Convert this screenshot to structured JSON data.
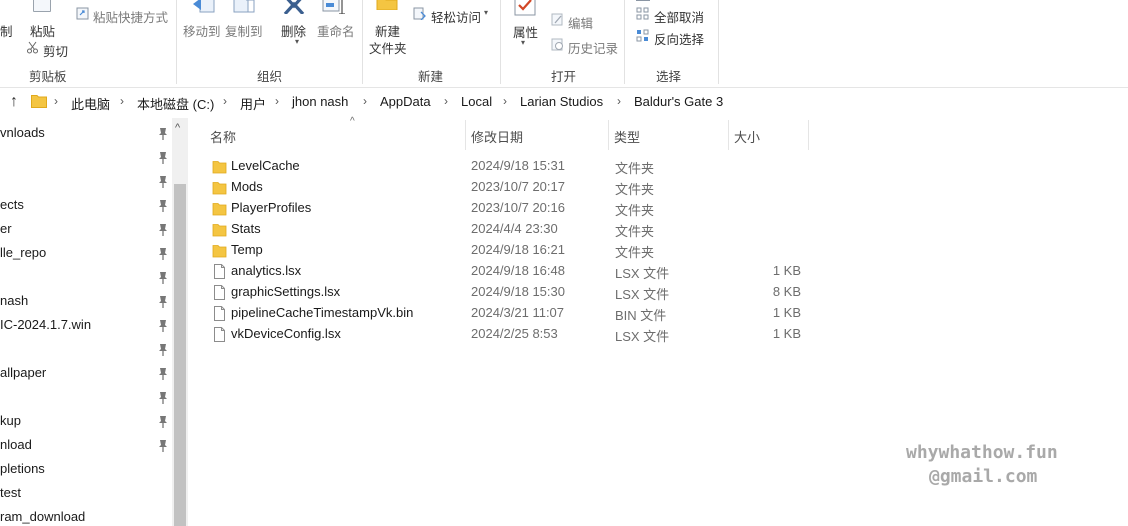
{
  "ribbon": {
    "clipboard": {
      "pin_label": "制",
      "copy_label": "复制",
      "paste_label": "粘贴",
      "paste_shortcut_label": "粘贴快捷方式",
      "cut_label": "剪切",
      "group_label": "剪贴板"
    },
    "organize": {
      "move_to_label": "移动到",
      "copy_to_label": "复制到",
      "delete_label": "删除",
      "rename_label": "重命名",
      "group_label": "组织"
    },
    "new": {
      "new_folder_line1": "新建",
      "new_folder_line2": "文件夹",
      "easy_access_label": "轻松访问",
      "group_label": "新建"
    },
    "open": {
      "properties_label": "属性",
      "edit_label": "编辑",
      "history_label": "历史记录",
      "group_label": "打开"
    },
    "select": {
      "select_none_label": "全部取消",
      "invert_selection_label": "反向选择",
      "group_label": "选择"
    }
  },
  "breadcrumb": [
    "此电脑",
    "本地磁盘 (C:)",
    "用户",
    "jhon nash",
    "AppData",
    "Local",
    "Larian Studios",
    "Baldur's Gate 3"
  ],
  "nav_items": [
    {
      "label": "vnloads",
      "pinned": true
    },
    {
      "label": "",
      "pinned": true
    },
    {
      "label": "",
      "pinned": true
    },
    {
      "label": "ects",
      "pinned": true
    },
    {
      "label": "er",
      "pinned": true
    },
    {
      "label": "lle_repo",
      "pinned": true
    },
    {
      "label": "",
      "pinned": true
    },
    {
      "label": " nash",
      "pinned": true
    },
    {
      "label": "IC-2024.1.7.win",
      "pinned": true
    },
    {
      "label": "",
      "pinned": true
    },
    {
      "label": "allpaper",
      "pinned": true
    },
    {
      "label": "",
      "pinned": true
    },
    {
      "label": "kup",
      "pinned": true
    },
    {
      "label": "nload",
      "pinned": true
    },
    {
      "label": "pletions",
      "pinned": false
    },
    {
      "label": "test",
      "pinned": false
    },
    {
      "label": "ram_download",
      "pinned": false
    }
  ],
  "columns": {
    "name": "名称",
    "date": "修改日期",
    "type": "类型",
    "size": "大小"
  },
  "files": [
    {
      "name": "LevelCache",
      "date": "2024/9/18 15:31",
      "type": "文件夹",
      "size": "",
      "icon": "folder-icon"
    },
    {
      "name": "Mods",
      "date": "2023/10/7 20:17",
      "type": "文件夹",
      "size": "",
      "icon": "folder-icon"
    },
    {
      "name": "PlayerProfiles",
      "date": "2023/10/7 20:16",
      "type": "文件夹",
      "size": "",
      "icon": "folder-icon"
    },
    {
      "name": "Stats",
      "date": "2024/4/4 23:30",
      "type": "文件夹",
      "size": "",
      "icon": "folder-icon"
    },
    {
      "name": "Temp",
      "date": "2024/9/18 16:21",
      "type": "文件夹",
      "size": "",
      "icon": "folder-icon"
    },
    {
      "name": "analytics.lsx",
      "date": "2024/9/18 16:48",
      "type": "LSX 文件",
      "size": "1 KB",
      "icon": "file-icon"
    },
    {
      "name": "graphicSettings.lsx",
      "date": "2024/9/18 15:30",
      "type": "LSX 文件",
      "size": "8 KB",
      "icon": "file-icon"
    },
    {
      "name": "pipelineCacheTimestampVk.bin",
      "date": "2024/3/21 11:07",
      "type": "BIN 文件",
      "size": "1 KB",
      "icon": "file-icon"
    },
    {
      "name": "vkDeviceConfig.lsx",
      "date": "2024/2/25 8:53",
      "type": "LSX 文件",
      "size": "1 KB",
      "icon": "file-icon"
    }
  ],
  "watermark": {
    "line1": "whywhathow.fun",
    "line2": "@gmail.com"
  },
  "colors": {
    "folder": "#f4c542",
    "folder_dark": "#e0a91c",
    "accent": "#4a8bd6",
    "delete_icon": "#3b5f8f",
    "properties_check": "#d24726"
  }
}
